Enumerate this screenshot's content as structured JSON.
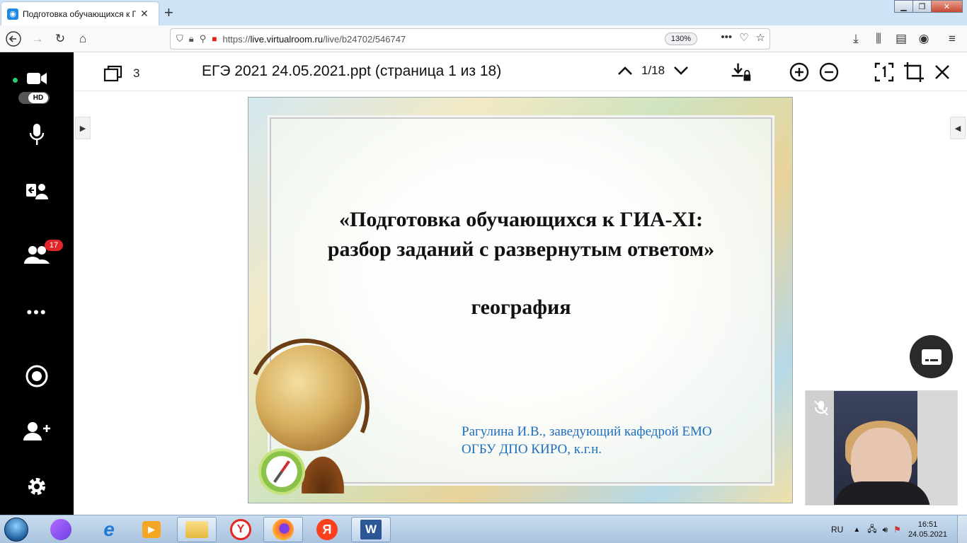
{
  "browser": {
    "tab_title": "Подготовка обучающихся к ГИА",
    "url_host": "live.virtualroom.ru",
    "url_prefix": "https://",
    "url_path": "/live/b24702/546747",
    "zoom": "130%"
  },
  "sidebar": {
    "hd_label": "HD",
    "participants_badge": "17"
  },
  "viewer": {
    "pages_count": "3",
    "doc_title": "ЕГЭ 2021 24.05.2021.ppt (страница 1 из 18)",
    "page_indicator": "1/18"
  },
  "slide": {
    "title_line1": "«Подготовка обучающихся к ГИА-XI:",
    "title_line2": "разбор заданий с развернутым ответом»",
    "subject": "география",
    "author_line1": "Рагулина И.В., заведующий кафедрой ЕМО",
    "author_line2": "ОГБУ ДПО КИРО, к.г.н."
  },
  "taskbar": {
    "language": "RU",
    "time": "16:51",
    "date": "24.05.2021"
  },
  "colors": {
    "sidebar_bg": "#000000",
    "badge": "#e0262b",
    "live_dot": "#2ecc71",
    "slide_author": "#1f6fbf"
  }
}
